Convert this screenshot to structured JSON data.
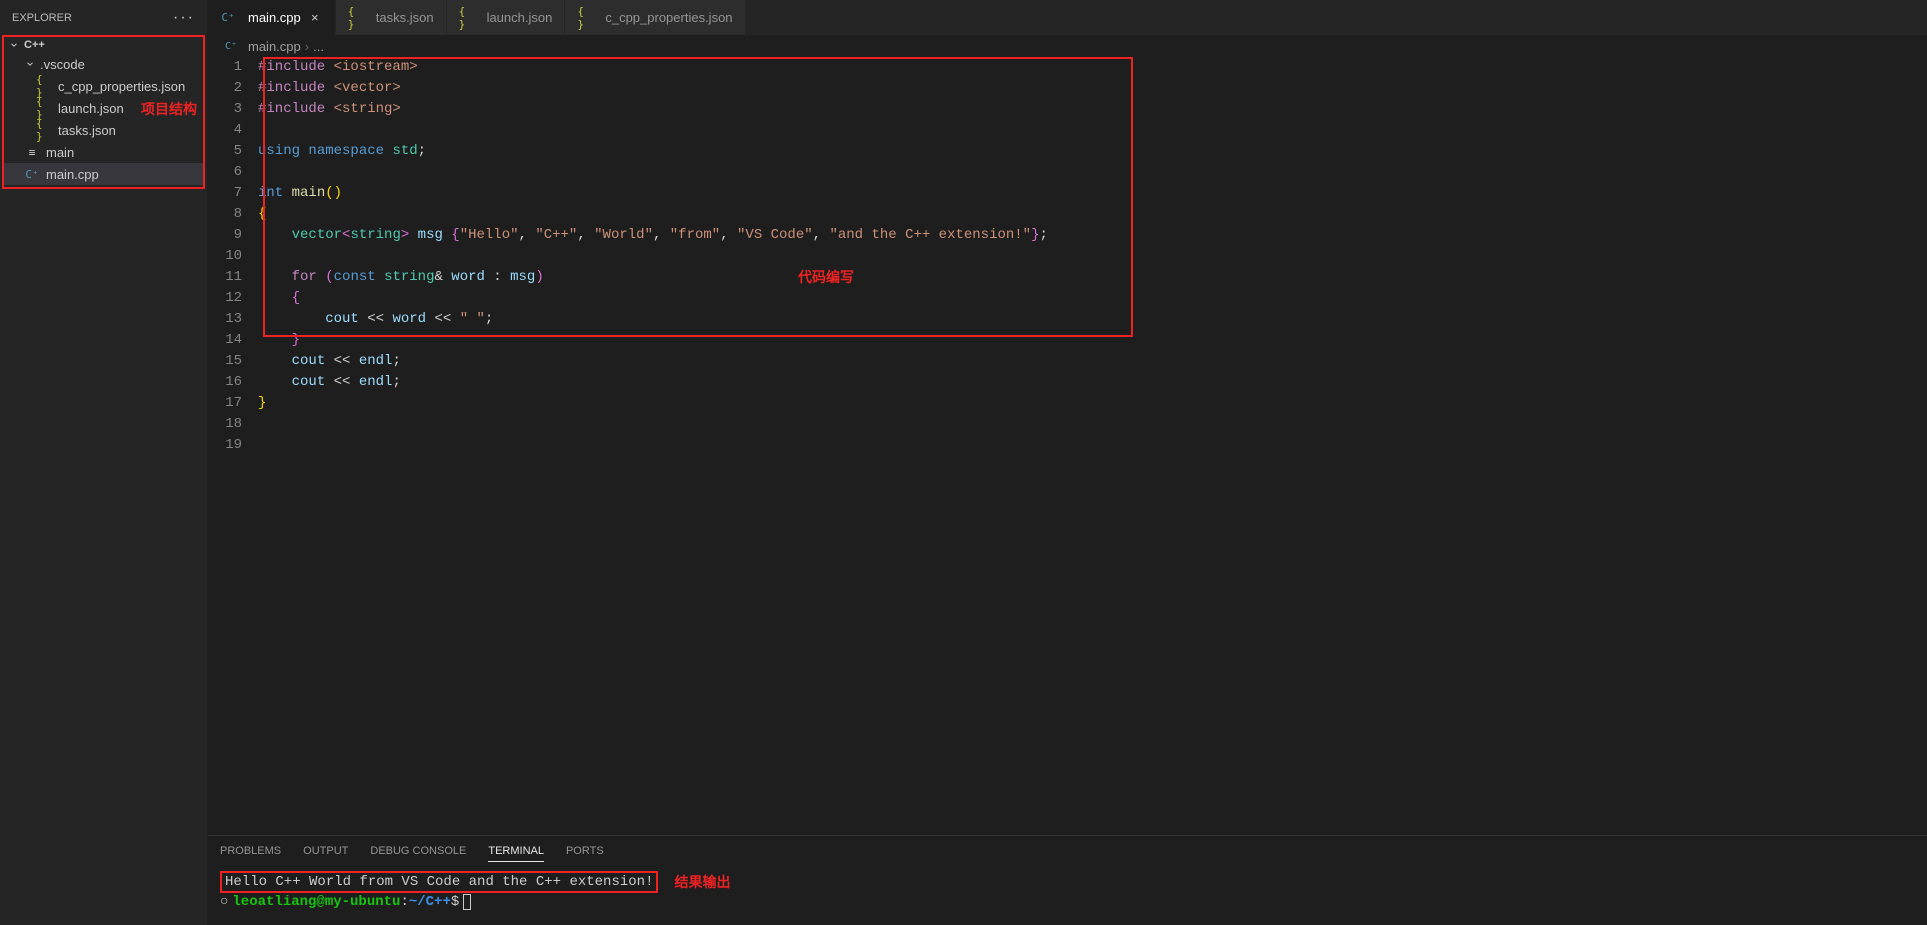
{
  "sidebar": {
    "title": "EXPLORER",
    "root": "C++",
    "items": [
      {
        "label": ".vscode",
        "type": "folder"
      },
      {
        "label": "c_cpp_properties.json",
        "type": "json"
      },
      {
        "label": "launch.json",
        "type": "json"
      },
      {
        "label": "tasks.json",
        "type": "json"
      },
      {
        "label": "main",
        "type": "exe"
      },
      {
        "label": "main.cpp",
        "type": "cpp"
      }
    ],
    "annotation": "项目结构"
  },
  "tabs": [
    {
      "label": "main.cpp",
      "icon": "cpp",
      "active": true,
      "closable": true
    },
    {
      "label": "tasks.json",
      "icon": "json",
      "active": false
    },
    {
      "label": "launch.json",
      "icon": "json",
      "active": false
    },
    {
      "label": "c_cpp_properties.json",
      "icon": "json",
      "active": false
    }
  ],
  "breadcrumb": {
    "file": "main.cpp",
    "more": "..."
  },
  "code": {
    "lines": [
      [
        {
          "c": "tok-pp",
          "t": "#include"
        },
        {
          "c": "",
          "t": " "
        },
        {
          "c": "tok-str",
          "t": "<iostream>"
        }
      ],
      [
        {
          "c": "tok-pp",
          "t": "#include"
        },
        {
          "c": "",
          "t": " "
        },
        {
          "c": "tok-str",
          "t": "<vector>"
        }
      ],
      [
        {
          "c": "tok-pp",
          "t": "#include"
        },
        {
          "c": "",
          "t": " "
        },
        {
          "c": "tok-str",
          "t": "<string>"
        }
      ],
      [],
      [
        {
          "c": "tok-kw",
          "t": "using"
        },
        {
          "c": "",
          "t": " "
        },
        {
          "c": "tok-kw",
          "t": "namespace"
        },
        {
          "c": "",
          "t": " "
        },
        {
          "c": "tok-namespace",
          "t": "std"
        },
        {
          "c": "",
          "t": ";"
        }
      ],
      [],
      [
        {
          "c": "tok-kw",
          "t": "int"
        },
        {
          "c": "",
          "t": " "
        },
        {
          "c": "tok-func",
          "t": "main"
        },
        {
          "c": "tok-yellow",
          "t": "()"
        }
      ],
      [
        {
          "c": "tok-yellow",
          "t": "{"
        }
      ],
      [
        {
          "c": "",
          "t": "    "
        },
        {
          "c": "tok-type",
          "t": "vector"
        },
        {
          "c": "tok-purple",
          "t": "<"
        },
        {
          "c": "tok-type",
          "t": "string"
        },
        {
          "c": "tok-purple",
          "t": ">"
        },
        {
          "c": "",
          "t": " "
        },
        {
          "c": "tok-var",
          "t": "msg"
        },
        {
          "c": "",
          "t": " "
        },
        {
          "c": "tok-purple",
          "t": "{"
        },
        {
          "c": "tok-str",
          "t": "\"Hello\""
        },
        {
          "c": "",
          "t": ", "
        },
        {
          "c": "tok-str",
          "t": "\"C++\""
        },
        {
          "c": "",
          "t": ", "
        },
        {
          "c": "tok-str",
          "t": "\"World\""
        },
        {
          "c": "",
          "t": ", "
        },
        {
          "c": "tok-str",
          "t": "\"from\""
        },
        {
          "c": "",
          "t": ", "
        },
        {
          "c": "tok-str",
          "t": "\"VS Code\""
        },
        {
          "c": "",
          "t": ", "
        },
        {
          "c": "tok-str",
          "t": "\"and the C++ extension!\""
        },
        {
          "c": "tok-purple",
          "t": "}"
        },
        {
          "c": "",
          "t": ";"
        }
      ],
      [],
      [
        {
          "c": "",
          "t": "    "
        },
        {
          "c": "tok-pp",
          "t": "for"
        },
        {
          "c": "",
          "t": " "
        },
        {
          "c": "tok-purple",
          "t": "("
        },
        {
          "c": "tok-kw",
          "t": "const"
        },
        {
          "c": "",
          "t": " "
        },
        {
          "c": "tok-type",
          "t": "string"
        },
        {
          "c": "tok-op",
          "t": "&"
        },
        {
          "c": "",
          "t": " "
        },
        {
          "c": "tok-var",
          "t": "word"
        },
        {
          "c": "",
          "t": " : "
        },
        {
          "c": "tok-var",
          "t": "msg"
        },
        {
          "c": "tok-purple",
          "t": ")"
        }
      ],
      [
        {
          "c": "",
          "t": "    "
        },
        {
          "c": "tok-purple",
          "t": "{"
        }
      ],
      [
        {
          "c": "",
          "t": "        "
        },
        {
          "c": "tok-var",
          "t": "cout"
        },
        {
          "c": "",
          "t": " "
        },
        {
          "c": "tok-op",
          "t": "<<"
        },
        {
          "c": "",
          "t": " "
        },
        {
          "c": "tok-var",
          "t": "word"
        },
        {
          "c": "",
          "t": " "
        },
        {
          "c": "tok-op",
          "t": "<<"
        },
        {
          "c": "",
          "t": " "
        },
        {
          "c": "tok-str",
          "t": "\" \""
        },
        {
          "c": "",
          "t": ";"
        }
      ],
      [
        {
          "c": "",
          "t": "    "
        },
        {
          "c": "tok-purple",
          "t": "}"
        }
      ],
      [
        {
          "c": "",
          "t": "    "
        },
        {
          "c": "tok-var",
          "t": "cout"
        },
        {
          "c": "",
          "t": " "
        },
        {
          "c": "tok-op",
          "t": "<<"
        },
        {
          "c": "",
          "t": " "
        },
        {
          "c": "tok-var",
          "t": "endl"
        },
        {
          "c": "",
          "t": ";"
        }
      ],
      [
        {
          "c": "",
          "t": "    "
        },
        {
          "c": "tok-var",
          "t": "cout"
        },
        {
          "c": "",
          "t": " "
        },
        {
          "c": "tok-op",
          "t": "<<"
        },
        {
          "c": "",
          "t": " "
        },
        {
          "c": "tok-var",
          "t": "endl"
        },
        {
          "c": "",
          "t": ";"
        }
      ],
      [
        {
          "c": "tok-yellow",
          "t": "}"
        }
      ],
      [],
      []
    ],
    "annotation": "代码编写"
  },
  "panel": {
    "tabs": [
      "PROBLEMS",
      "OUTPUT",
      "DEBUG CONSOLE",
      "TERMINAL",
      "PORTS"
    ],
    "active": "TERMINAL",
    "output": "Hello C++ World from VS Code and the C++ extension!",
    "annotation": "结果输出",
    "prompt_user": "leoatliang@my-ubuntu",
    "prompt_path": "~/C++",
    "prompt_sep": ":",
    "prompt_end": "$"
  }
}
